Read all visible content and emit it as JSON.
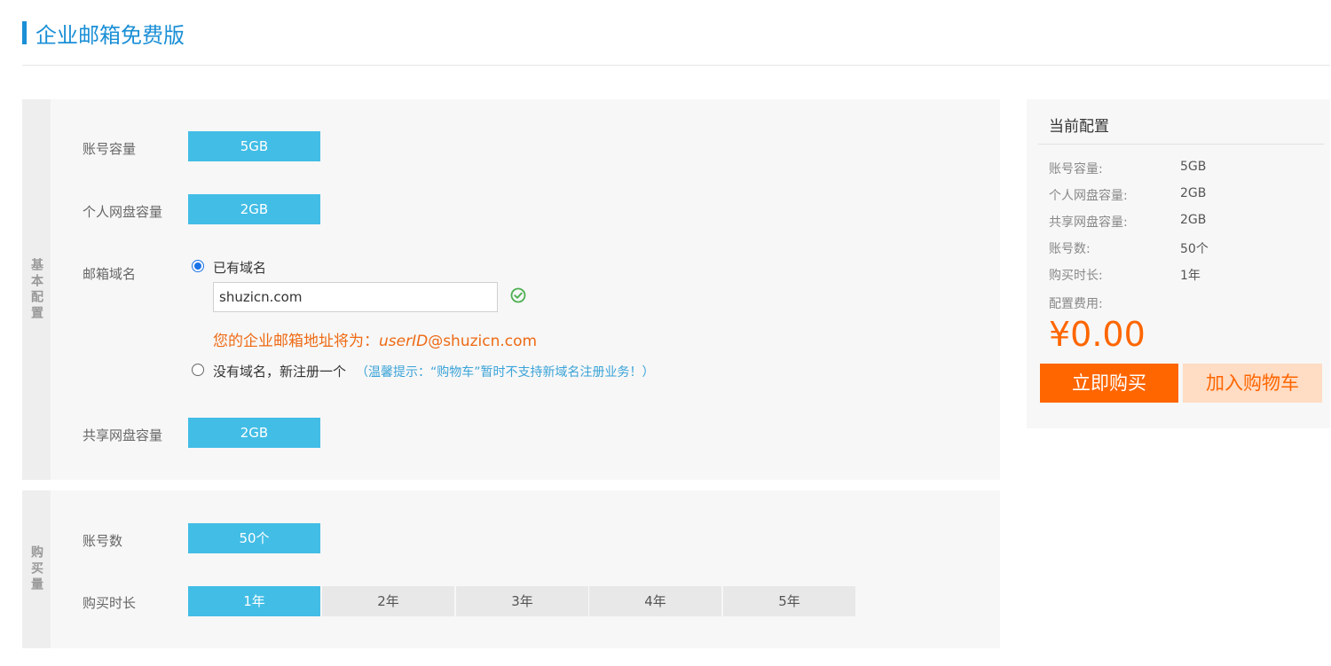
{
  "header": {
    "title": "企业邮箱免费版"
  },
  "basic": {
    "side_label": "基本配置",
    "account_capacity": {
      "label": "账号容量",
      "value": "5GB"
    },
    "personal_disk": {
      "label": "个人网盘容量",
      "value": "2GB"
    },
    "domain": {
      "label": "邮箱域名",
      "option_existing": "已有域名",
      "input_value": "shuzicn.com",
      "address_prefix": "您的企业邮箱地址将为：",
      "address_user": "userID",
      "address_domain": "@shuzicn.com",
      "option_new": "没有域名，新注册一个",
      "tip": "（温馨提示：“购物车”暂时不支持新域名注册业务！）"
    },
    "shared_disk": {
      "label": "共享网盘容量",
      "value": "2GB"
    }
  },
  "purchase": {
    "side_label": "购买量",
    "account_count": {
      "label": "账号数",
      "value": "50个"
    },
    "duration": {
      "label": "购买时长",
      "options": [
        "1年",
        "2年",
        "3年",
        "4年",
        "5年"
      ],
      "selected_index": 0
    }
  },
  "config": {
    "title": "当前配置",
    "rows": [
      {
        "label": "账号容量:",
        "value": "5GB"
      },
      {
        "label": "个人网盘容量:",
        "value": "2GB"
      },
      {
        "label": "共享网盘容量:",
        "value": "2GB"
      },
      {
        "label": "账号数:",
        "value": "50个"
      },
      {
        "label": "购买时长:",
        "value": "1年"
      }
    ],
    "fee_label": "配置费用:",
    "price": "¥0.00",
    "buy_label": "立即购买",
    "cart_label": "加入购物车"
  },
  "colors": {
    "accent_blue": "#1a8fd6",
    "chip_blue": "#42bde6",
    "orange": "#ff6600",
    "tip_blue": "#3aa3d8",
    "check_green": "#4caf50"
  }
}
